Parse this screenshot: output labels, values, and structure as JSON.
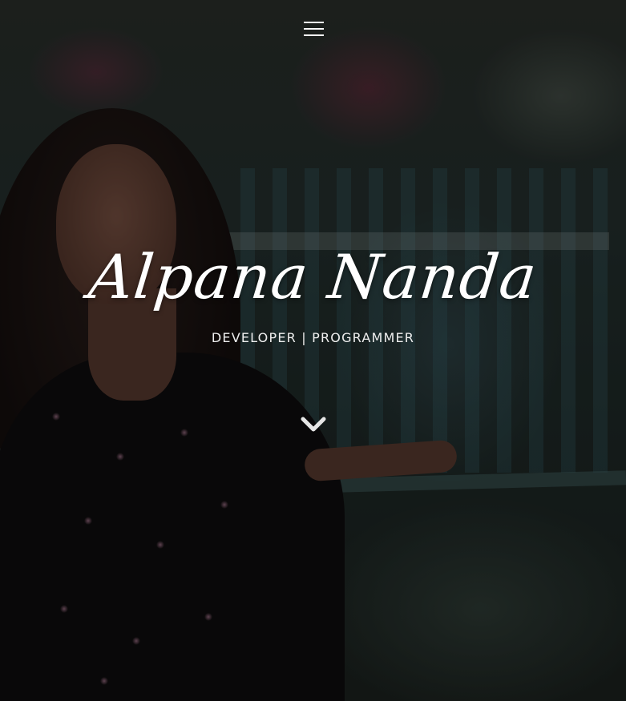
{
  "hero": {
    "name": "Alpana Nanda",
    "subtitle": "DEVELOPER | PROGRAMMER",
    "background_image": "portrait-photo"
  },
  "nav": {
    "menu_icon": "hamburger-menu-icon"
  },
  "scroll": {
    "icon": "chevron-down-icon"
  },
  "colors": {
    "text": "#ffffff",
    "overlay": "#000000"
  }
}
